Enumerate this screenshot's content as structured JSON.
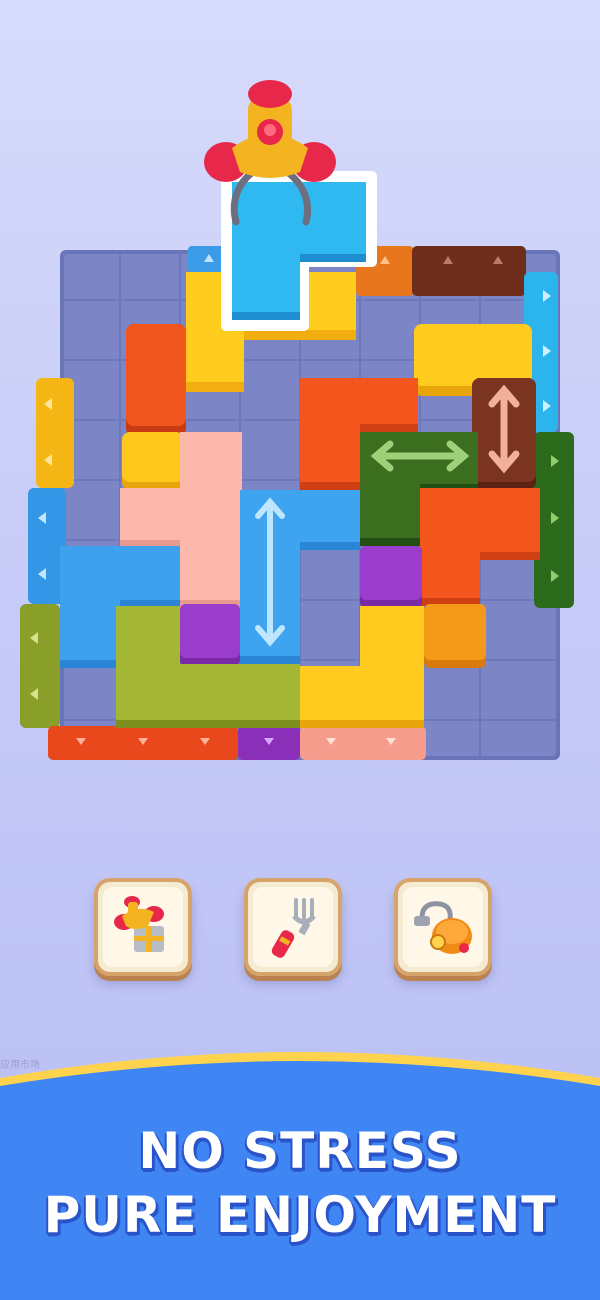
{
  "headline": {
    "line1": "NO STRESS",
    "line2": "PURE ENJOYMENT"
  },
  "watermark": "应用市场",
  "tools": [
    {
      "name": "claw-gift",
      "icon": "claw-gift-icon"
    },
    {
      "name": "fork",
      "icon": "fork-icon"
    },
    {
      "name": "vacuum",
      "icon": "vacuum-icon"
    }
  ],
  "colors": {
    "background": "#c6cbf7",
    "banner": "#3f86f4",
    "banner_edge": "#ffd34d",
    "board_floor": "#6a74b8",
    "headline_text": "#ffffff",
    "tile_frame": "#d6a36a"
  }
}
